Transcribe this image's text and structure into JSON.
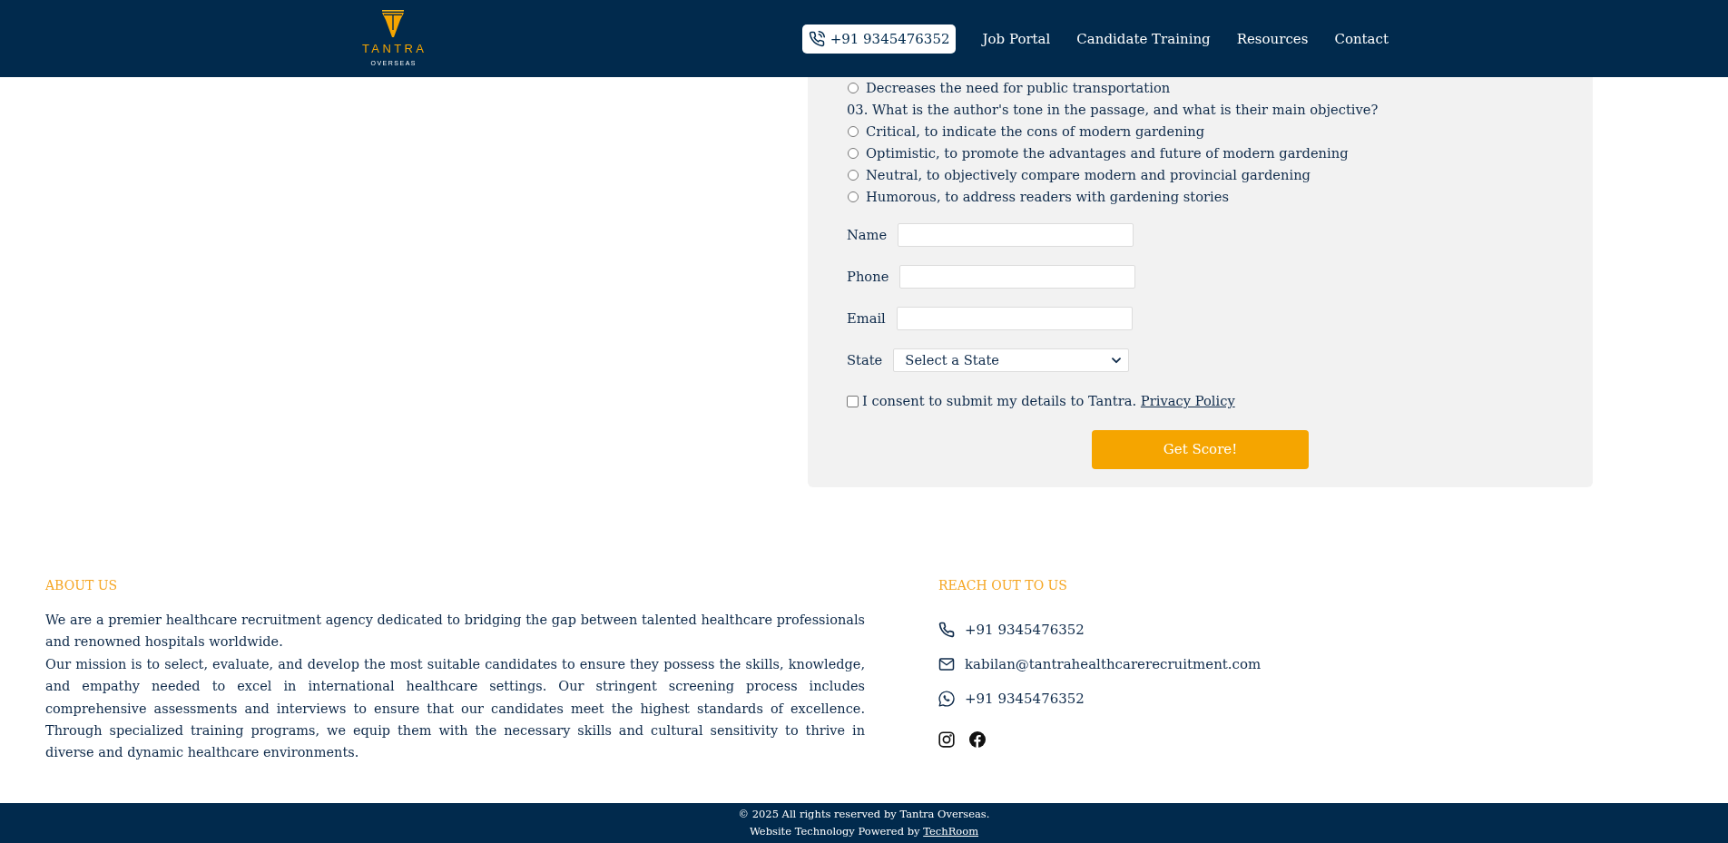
{
  "header": {
    "logo": {
      "wordmark": "TANTRA",
      "tagline": "OVERSEAS"
    },
    "phone_button": "+91 9345476352",
    "nav_links": [
      "Job Portal",
      "Candidate Training",
      "Resources",
      "Contact"
    ]
  },
  "quiz_form": {
    "questions": [
      {
        "options": [
          {
            "label": "Decreases the need for public transportation",
            "selected": false
          }
        ]
      },
      {
        "question": "03. What is the author's tone in the passage, and what is their main objective?",
        "options": [
          {
            "label": "Critical, to indicate the cons of modern gardening",
            "selected": false
          },
          {
            "label": "Optimistic, to promote the advantages and future of modern gardening",
            "selected": false
          },
          {
            "label": "Neutral, to objectively compare modern and provincial gardening",
            "selected": false
          },
          {
            "label": "Humorous, to address readers with gardening stories",
            "selected": false
          }
        ]
      }
    ],
    "fields": [
      {
        "kind": "text",
        "label": "Name"
      },
      {
        "kind": "text",
        "label": "Phone"
      },
      {
        "kind": "text",
        "label": "Email"
      },
      {
        "kind": "select",
        "label": "State",
        "value": "Select a State"
      }
    ],
    "consent": {
      "checked": false,
      "text": "I consent to submit my details to Tantra.",
      "link": "Privacy Policy"
    },
    "submit_button": "Get Score!"
  },
  "footer": {
    "about": {
      "heading": "ABOUT US",
      "paragraphs": [
        "We are a premier healthcare recruitment agency dedicated to bridging the gap between talented healthcare professionals and renowned hospitals worldwide.",
        "Our mission is to select, evaluate, and develop the most suitable candidates to ensure they possess the skills, knowledge, and empathy needed to excel in international healthcare settings. Our stringent screening process includes comprehensive assessments and interviews to ensure that our candidates meet the highest standards of excellence. Through specialized training programs, we equip them with the necessary skills and cultural sensitivity to thrive in diverse and dynamic healthcare environments."
      ]
    },
    "contact": {
      "heading": "REACH OUT TO US",
      "items": [
        {
          "kind": "phone",
          "text": "+91 9345476352"
        },
        {
          "kind": "email",
          "text": "kabilan@tantrahealthcarerecruitment.com"
        },
        {
          "kind": "whatsapp",
          "text": "+91 9345476352"
        }
      ]
    }
  },
  "bottom_bar": {
    "copyright": "© 2025 All rights reserved by Tantra Overseas.",
    "credit": "Website Technology Powered by",
    "credit_link": "TechRoom"
  }
}
